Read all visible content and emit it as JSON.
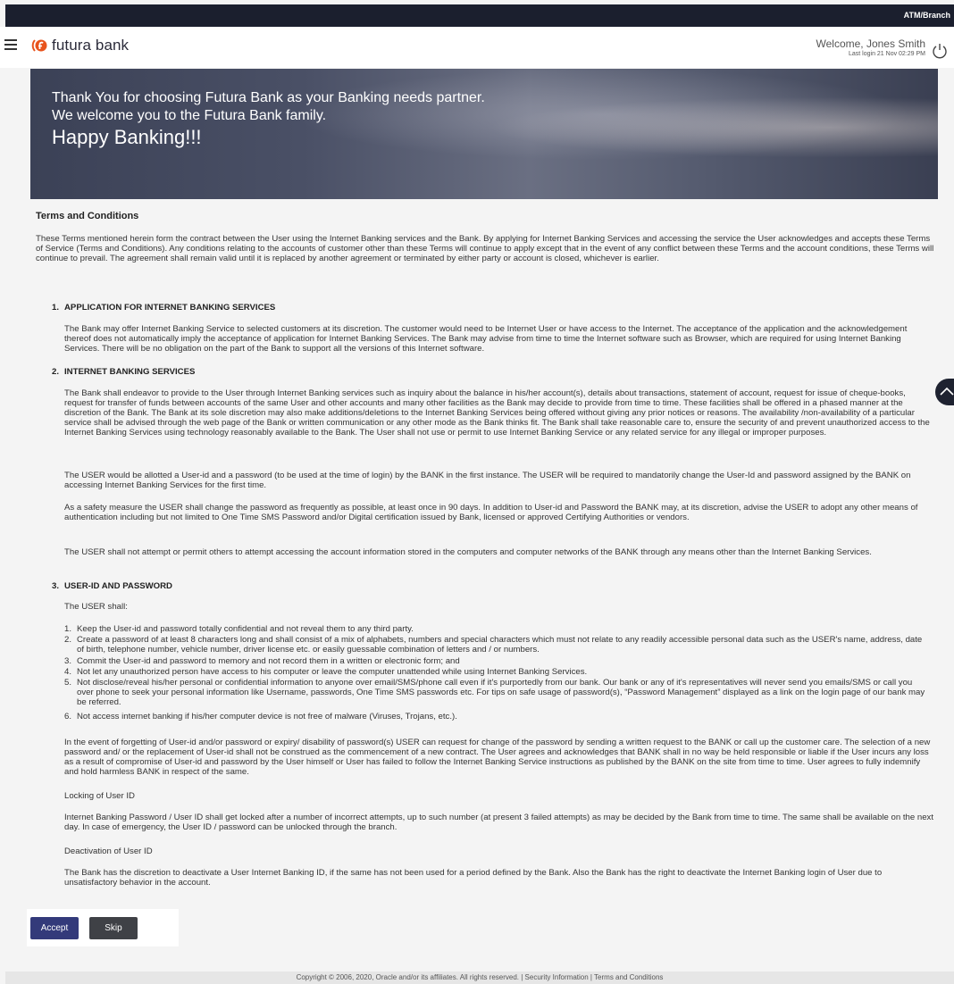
{
  "topbar": {
    "label": "ATM/Branch"
  },
  "header": {
    "brand": "futura bank",
    "welcome": "Welcome, Jones Smith",
    "last_login": "Last login 21 Nov 02:29 PM"
  },
  "banner": {
    "line1": "Thank You for choosing Futura Bank as your Banking needs partner.",
    "line2": "We welcome you to the Futura Bank family.",
    "line3": "Happy Banking!!!"
  },
  "terms": {
    "title": "Terms and Conditions",
    "intro": "These Terms mentioned herein form the contract between the User using the Internet Banking services and the Bank. By applying for Internet Banking Services and accessing the service the User acknowledges and accepts these Terms of Service (Terms and Conditions). Any conditions relating to the accounts of customer other than these Terms will continue to apply except that in the event of any conflict between these Terms and the account conditions, these Terms will continue to prevail. The agreement shall remain valid until it is replaced by another agreement or terminated by either party or account is closed, whichever is earlier.",
    "s1_num": "1.",
    "s1_title": "APPLICATION FOR INTERNET BANKING SERVICES",
    "s1_p1": "The Bank may offer Internet Banking Service to selected customers at its discretion. The customer would need to be Internet User or have access to the Internet. The acceptance of the application and the acknowledgement thereof does not automatically imply the acceptance of application for Internet Banking Services. The Bank may advise from time to time the Internet software such as Browser, which are required for using Internet Banking Services. There will be no obligation on the part of the Bank to support all the versions of this Internet software.",
    "s2_num": "2.",
    "s2_title": "INTERNET BANKING SERVICES",
    "s2_p1": "The Bank shall endeavor to provide to the User through Internet Banking services such as inquiry about the balance in his/her account(s), details about transactions, statement of account, request for issue of cheque-books, request for transfer of funds between accounts of the same User and other accounts and many other facilities as the Bank may decide to provide from time to time. These facilities shall be offered in a phased manner at the discretion of the Bank. The Bank at its sole discretion may also make additions/deletions to the Internet Banking Services being offered without giving any prior notices or reasons. The availability /non-availability of a particular service shall be advised through the web page of the Bank or written communication or any other mode as the Bank thinks fit. The Bank shall take reasonable care to, ensure the security of and prevent unauthorized access to the Internet Banking Services using technology reasonably available to the Bank. The User shall not use or permit to use Internet Banking Service or any related service for any illegal or improper purposes.",
    "s2_p2": "The USER would be allotted a User-id and a password (to be used at the time of login) by the BANK in the first instance. The USER will be required to mandatorily change the User-Id and password assigned by the BANK on accessing Internet Banking Services for the first time.",
    "s2_p3": "As a safety measure the USER shall change the password as frequently as possible, at least once in 90 days. In addition to User-id and Password the BANK may, at its discretion, advise the USER to adopt any other means of authentication including but not limited to One Time SMS Password and/or Digital certification issued by Bank, licensed or approved Certifying Authorities or vendors.",
    "s2_p4": "The USER shall not attempt or permit others to attempt accessing the account information stored in the computers and computer networks of the BANK through any means other than the Internet Banking Services.",
    "s3_num": "3.",
    "s3_title": "USER-ID AND PASSWORD",
    "s3_p1": "The USER shall:",
    "items": [
      {
        "n": "1.",
        "t": "Keep the User-id and password totally confidential and not reveal them to any third party."
      },
      {
        "n": "2.",
        "t": "Create a password of at least 8 characters long and shall consist of a mix of alphabets, numbers and special characters which must not relate to any readily accessible personal data such as the USER's name, address, date of birth, telephone number, vehicle number, driver license etc. or easily guessable combination of letters and / or numbers."
      },
      {
        "n": "3.",
        "t": "Commit the User-id and password to memory and not record them in a written or electronic form; and"
      },
      {
        "n": "4.",
        "t": "Not let any unauthorized person have access to his computer or leave the computer unattended while using Internet Banking Services."
      },
      {
        "n": "5.",
        "t": "Not disclose/reveal his/her personal or confidential information to anyone over email/SMS/phone call even if it's purportedly from our bank. Our bank or any of it's representatives will never send you emails/SMS or call you over phone to seek your personal information like Username, passwords, One Time SMS passwords etc. For tips on safe usage of password(s), “Password Management” displayed as a link on the login page of our bank may be referred."
      },
      {
        "n": "6.",
        "t": "Not access internet banking if his/her computer device is not free of malware (Viruses, Trojans, etc.)."
      }
    ],
    "s3_p2": "In the event of forgetting of User-id and/or password or expiry/ disability of password(s) USER can request for change of the password by sending a written request to the BANK or call up the customer care. The selection of a new password and/ or the replacement of User-id shall not be construed as the commencement of a new contract. The User agrees and acknowledges that BANK shall in no way be held responsible or liable if the User incurs any loss as a result of compromise of User-id and password by the User himself or User has failed to follow the Internet Banking Service instructions as published by the BANK on the site from time to time. User agrees to fully indemnify and hold harmless BANK in respect of the same.",
    "locking_title": "Locking of User ID",
    "locking_p": "Internet Banking Password / User ID shall get locked after a number of incorrect attempts, up to such number (at present 3 failed attempts) as may be decided by the Bank from time to time. The same shall be available on the next day. In case of emergency, the User ID / password can be unlocked through the branch.",
    "deact_title": "Deactivation of User ID",
    "deact_p": "The Bank has the discretion to deactivate a User Internet Banking ID, if the same has not been used for a period defined by the Bank. Also the Bank has the right to deactivate the Internet Banking login of User due to unsatisfactory behavior in the account."
  },
  "actions": {
    "accept": "Accept",
    "skip": "Skip"
  },
  "footer": {
    "text": "Copyright © 2006, 2020, Oracle and/or its affiliates. All rights reserved. | Security Information | Terms and Conditions"
  },
  "icons": {
    "menu": "hamburger-icon",
    "logo": "futura-logo-icon",
    "power": "power-icon",
    "scroll": "chevron-up-icon"
  },
  "colors": {
    "accept": "#333a7a",
    "skip": "#3f4146",
    "topbar": "#1b1f2e"
  }
}
